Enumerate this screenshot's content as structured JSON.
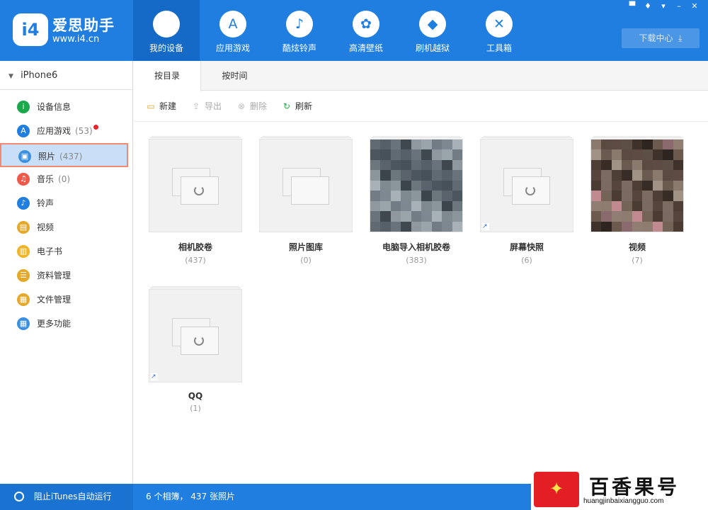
{
  "app": {
    "logo_mark": "i4",
    "name": "爱思助手",
    "url": "www.i4.cn"
  },
  "nav": [
    {
      "label": "我的设备",
      "icon": "apple-icon",
      "glyph": "",
      "active": true
    },
    {
      "label": "应用游戏",
      "icon": "app-store-icon",
      "glyph": "A"
    },
    {
      "label": "酷炫铃声",
      "icon": "bell-icon",
      "glyph": "♪"
    },
    {
      "label": "高清壁纸",
      "icon": "flower-icon",
      "glyph": "✿"
    },
    {
      "label": "刷机越狱",
      "icon": "dropbox-icon",
      "glyph": "◆"
    },
    {
      "label": "工具箱",
      "icon": "tools-icon",
      "glyph": "✕"
    }
  ],
  "download_center": "下载中心",
  "device_name": "iPhone6",
  "sidebar": [
    {
      "label": "设备信息",
      "icon": "info-icon",
      "color": "#1aa84a",
      "glyph": "i",
      "count": ""
    },
    {
      "label": "应用游戏",
      "icon": "app-store-icon",
      "color": "#1f7ee0",
      "glyph": "A",
      "count": "(53)",
      "dot": true
    },
    {
      "label": "照片",
      "icon": "photo-icon",
      "color": "#3b8fe0",
      "glyph": "▣",
      "count": "(437)",
      "active": true
    },
    {
      "label": "音乐",
      "icon": "music-icon",
      "color": "#f0584a",
      "glyph": "♫",
      "count": "(0)"
    },
    {
      "label": "铃声",
      "icon": "bell-icon",
      "color": "#1f7ee0",
      "glyph": "♪",
      "count": ""
    },
    {
      "label": "视频",
      "icon": "video-icon",
      "color": "#e4a82a",
      "glyph": "▤",
      "count": ""
    },
    {
      "label": "电子书",
      "icon": "book-icon",
      "color": "#f0b428",
      "glyph": "▥",
      "count": ""
    },
    {
      "label": "资料管理",
      "icon": "contacts-icon",
      "color": "#e4a82a",
      "glyph": "☰",
      "count": ""
    },
    {
      "label": "文件管理",
      "icon": "file-icon",
      "color": "#e4a82a",
      "glyph": "▦",
      "count": ""
    },
    {
      "label": "更多功能",
      "icon": "more-icon",
      "color": "#3b8fe0",
      "glyph": "▦",
      "count": ""
    }
  ],
  "tabs": [
    {
      "label": "按目录",
      "active": true
    },
    {
      "label": "按时间"
    }
  ],
  "toolbar": [
    {
      "label": "新建",
      "icon": "new-folder-icon",
      "glyph": "▭",
      "disabled": false
    },
    {
      "label": "导出",
      "icon": "export-icon",
      "glyph": "⇪",
      "disabled": true
    },
    {
      "label": "删除",
      "icon": "delete-icon",
      "glyph": "⊗",
      "disabled": true
    },
    {
      "label": "刷新",
      "icon": "refresh-icon",
      "glyph": "↻",
      "disabled": false
    }
  ],
  "albums": [
    {
      "title": "相机胶卷",
      "count": "(437)",
      "type": "placeholder",
      "shortcut": false
    },
    {
      "title": "照片图库",
      "count": "(0)",
      "type": "empty",
      "shortcut": false
    },
    {
      "title": "电脑导入相机胶卷",
      "count": "(383)",
      "type": "mosaic-gray",
      "shortcut": false
    },
    {
      "title": "屏幕快照",
      "count": "(6)",
      "type": "placeholder",
      "shortcut": true
    },
    {
      "title": "视频",
      "count": "(7)",
      "type": "mosaic-warm",
      "shortcut": false
    },
    {
      "title": "QQ",
      "count": "(1)",
      "type": "placeholder",
      "shortcut": true
    }
  ],
  "status": {
    "itunes_block": "阻止iTunes自动运行",
    "summary": "6 个相簿， 437 张照片"
  },
  "watermark": {
    "title": "百香果号",
    "url": "huangjinbaixiangguo.com"
  }
}
